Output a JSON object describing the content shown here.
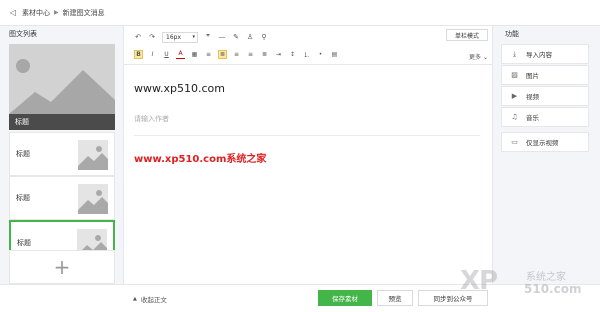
{
  "breadcrumb": {
    "root": "素材中心",
    "separator": "▶",
    "current": "新建图文消息"
  },
  "sidebar": {
    "title": "图文列表",
    "cover": {
      "caption": "标题"
    },
    "items": [
      {
        "title": "标题"
      },
      {
        "title": "标题"
      },
      {
        "title": "标题"
      }
    ],
    "add_label": "+"
  },
  "toolbar": {
    "font_size": "16px",
    "single_mode": "单栏模式",
    "more": "更多",
    "more_chevron": "⌄"
  },
  "editor": {
    "title_value": "www.xp510.com",
    "author_placeholder": "请输入作者",
    "body_text": "www.xp510.com系统之家"
  },
  "right_panel": {
    "title": "功能",
    "buttons": [
      {
        "label": "导入内容",
        "icon": "import-icon"
      },
      {
        "label": "图片",
        "icon": "image-icon"
      },
      {
        "label": "视频",
        "icon": "video-icon"
      },
      {
        "label": "音乐",
        "icon": "music-icon"
      },
      {
        "label": "仅显示视频",
        "icon": "video-only-icon"
      }
    ]
  },
  "bottom": {
    "collapse_label": "收起正文",
    "save_label": "保存素材",
    "preview_label": "预览",
    "sync_label": "同步到公众号"
  },
  "watermark": {
    "logo": "XP",
    "cn": "系统之家",
    "num": "510.com"
  },
  "colors": {
    "accent": "#44b549",
    "body_text": "#e02020",
    "panel_bg": "#f4f5f9"
  }
}
